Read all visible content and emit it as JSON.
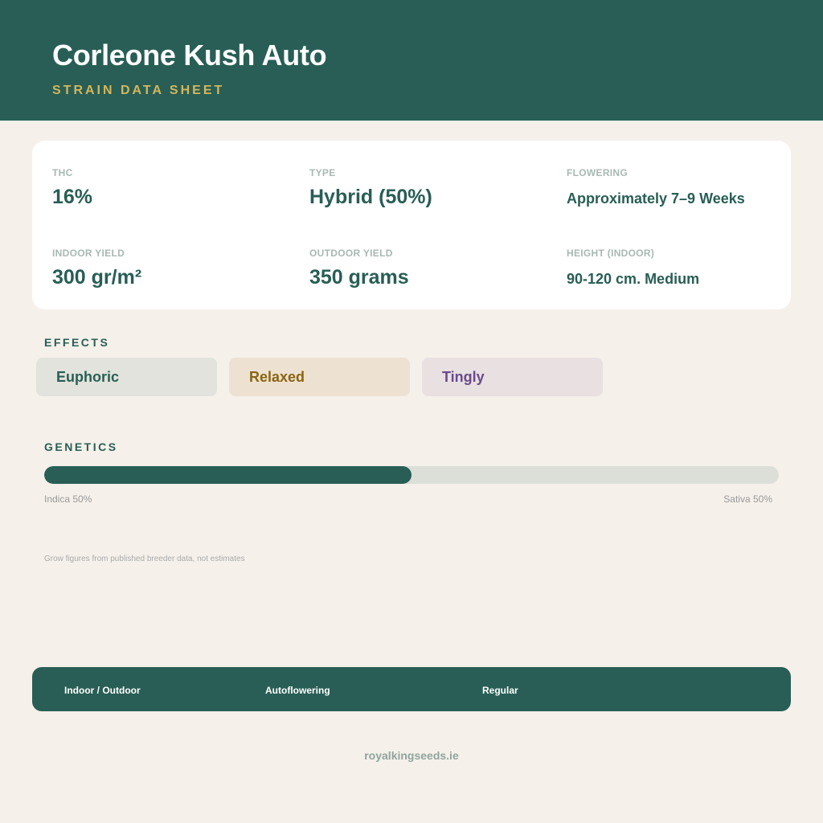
{
  "header": {
    "title": "Corleone Kush Auto",
    "subtitle": "STRAIN DATA SHEET"
  },
  "stats": {
    "thc": {
      "label": "THC",
      "value": "16%"
    },
    "type": {
      "label": "TYPE",
      "value": "Hybrid (50%)"
    },
    "flowering": {
      "label": "FLOWERING",
      "value": "Approximately 7–9 Weeks"
    },
    "indoor_yield": {
      "label": "INDOOR YIELD",
      "value": "300 gr/m²"
    },
    "outdoor_yield": {
      "label": "OUTDOOR YIELD",
      "value": "350 grams"
    },
    "height": {
      "label": "HEIGHT (INDOOR)",
      "value": "90-120 cm. Medium"
    }
  },
  "effects": {
    "title": "EFFECTS",
    "items": [
      {
        "label": "Euphoric",
        "bg": "#e2e3dc",
        "color": "#285e55"
      },
      {
        "label": "Relaxed",
        "bg": "#ede2d2",
        "color": "#8a6512"
      },
      {
        "label": "Tingly",
        "bg": "#e8e0e1",
        "color": "#6a4a8c"
      }
    ]
  },
  "genetics": {
    "title": "GENETICS",
    "indica_fraction": 0.5,
    "indica_label": "Indica 50%",
    "sativa_label": "Sativa 50%"
  },
  "note": "Grow figures from published breeder data, not estimates",
  "footer_tags": [
    "Indoor / Outdoor",
    "Autoflowering",
    "Regular"
  ],
  "website": "royalkingseeds.ie",
  "colors": {
    "brand": "#285e55",
    "accent": "#d4b65c",
    "background": "#f5f0ea"
  }
}
